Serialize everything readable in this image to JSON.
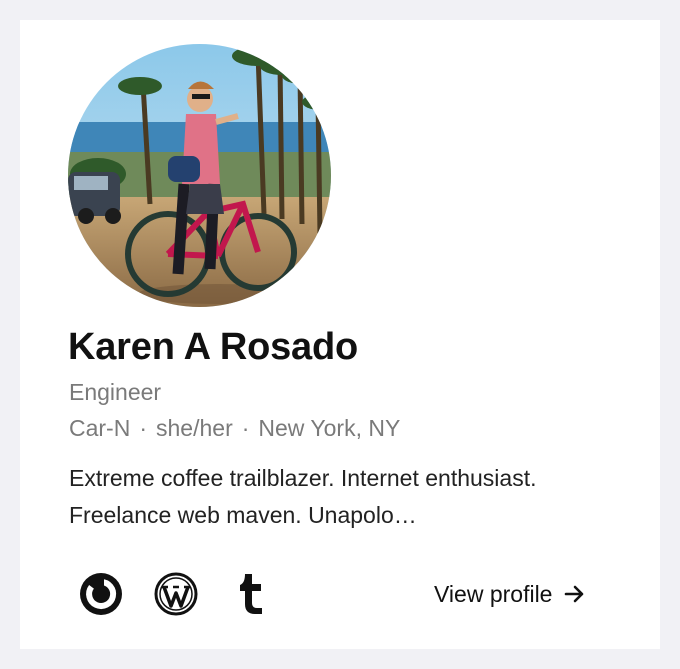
{
  "profile": {
    "name": "Karen A Rosado",
    "title": "Engineer",
    "meta": {
      "org": "Car-N",
      "separator": "·",
      "pronouns": "she/her",
      "location": "New York, NY"
    },
    "bio": "Extreme coffee trailblazer. Internet enthusiast. Freelance web maven. Unapolo…",
    "view_profile_label": "View profile"
  },
  "socials": [
    {
      "icon": "power-icon"
    },
    {
      "icon": "wordpress-icon"
    },
    {
      "icon": "tumblr-icon"
    }
  ],
  "colors": {
    "page_background": "#f1f1f5",
    "card_background": "#ffffff",
    "text_primary": "#111111",
    "text_secondary": "#7a7a7a"
  }
}
